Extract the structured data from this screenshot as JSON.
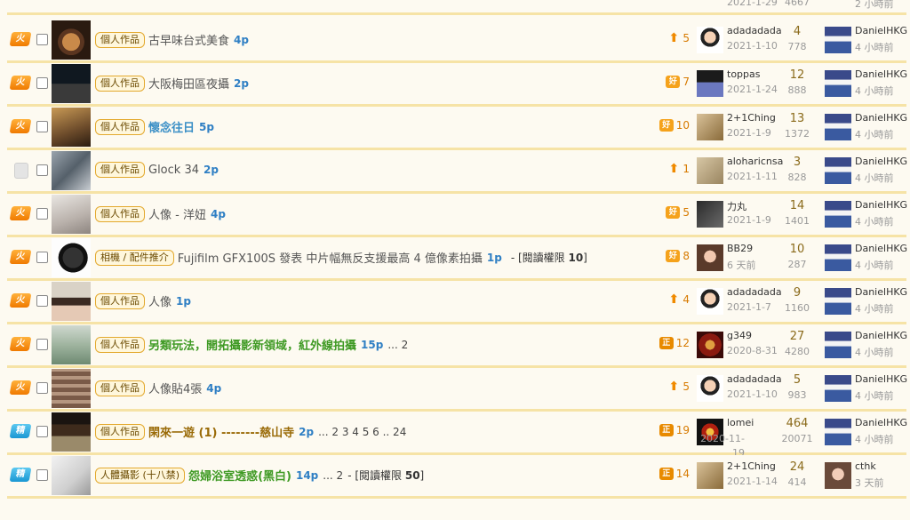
{
  "colors": {
    "row_bg": "#fdfaf1",
    "separator": "#f6e3a6",
    "pages_blue": "#2f7fc4",
    "rating_orange": "#d77a00"
  },
  "top_row": {
    "date": "2021-1-29",
    "views": "4667",
    "last_time": "2 小時前"
  },
  "threads": [
    {
      "status": "hot",
      "status_label": "火",
      "tag": "個人作品",
      "title": "古早味台式美食",
      "title_style": "normal",
      "pages": "4p",
      "page_nums": "",
      "perm_label": "",
      "perm_value": "",
      "perm_close": "",
      "rating_icon": "arrow",
      "rating_label": "⬆",
      "rating": "5",
      "author": "adadadada",
      "date": "2021-1-10",
      "replies": "4",
      "views": "778",
      "last_user": "DanielHKG",
      "last_time": "4 小時前"
    },
    {
      "status": "hot",
      "status_label": "火",
      "tag": "個人作品",
      "title": "大阪梅田區夜攝",
      "title_style": "normal",
      "pages": "2p",
      "page_nums": "",
      "perm_label": "",
      "perm_value": "",
      "perm_close": "",
      "rating_icon": "good",
      "rating_label": "好",
      "rating": "7",
      "author": "toppas",
      "date": "2021-1-24",
      "replies": "12",
      "views": "888",
      "last_user": "DanielHKG",
      "last_time": "4 小時前"
    },
    {
      "status": "hot",
      "status_label": "火",
      "tag": "個人作品",
      "title": "懷念往日",
      "title_style": "blue",
      "pages": "5p",
      "page_nums": "",
      "perm_label": "",
      "perm_value": "",
      "perm_close": "",
      "rating_icon": "good",
      "rating_label": "好",
      "rating": "10",
      "author": "2+1Ching",
      "date": "2021-1-9",
      "replies": "13",
      "views": "1372",
      "last_user": "DanielHKG",
      "last_time": "4 小時前"
    },
    {
      "status": "normal",
      "status_label": "",
      "tag": "個人作品",
      "title": "Glock 34",
      "title_style": "normal",
      "pages": "2p",
      "page_nums": "",
      "perm_label": "",
      "perm_value": "",
      "perm_close": "",
      "rating_icon": "arrow",
      "rating_label": "⬆",
      "rating": "1",
      "author": "aloharicnsa",
      "date": "2021-1-11",
      "replies": "3",
      "views": "828",
      "last_user": "DanielHKG",
      "last_time": "4 小時前"
    },
    {
      "status": "hot",
      "status_label": "火",
      "tag": "個人作品",
      "title": "人像 - 洋妞",
      "title_style": "normal",
      "pages": "4p",
      "page_nums": "",
      "perm_label": "",
      "perm_value": "",
      "perm_close": "",
      "rating_icon": "good",
      "rating_label": "好",
      "rating": "5",
      "author": "力丸",
      "date": "2021-1-9",
      "replies": "14",
      "views": "1401",
      "last_user": "DanielHKG",
      "last_time": "4 小時前"
    },
    {
      "status": "hot",
      "status_label": "火",
      "tag": "相機 / 配件推介",
      "title": "Fujifilm GFX100S 發表 中片幅無反支援最高 4 億像素拍攝",
      "title_style": "normal",
      "pages": "1p",
      "page_nums": "",
      "perm_label": "- [閱讀權限",
      "perm_value": "10",
      "perm_close": "]",
      "rating_icon": "good",
      "rating_label": "好",
      "rating": "8",
      "author": "BB29",
      "date": "6 天前",
      "replies": "10",
      "views": "287",
      "last_user": "DanielHKG",
      "last_time": "4 小時前"
    },
    {
      "status": "hot",
      "status_label": "火",
      "tag": "個人作品",
      "title": "人像",
      "title_style": "normal",
      "pages": "1p",
      "page_nums": "",
      "perm_label": "",
      "perm_value": "",
      "perm_close": "",
      "rating_icon": "arrow",
      "rating_label": "⬆",
      "rating": "4",
      "author": "adadadada",
      "date": "2021-1-7",
      "replies": "9",
      "views": "1160",
      "last_user": "DanielHKG",
      "last_time": "4 小時前"
    },
    {
      "status": "hot",
      "status_label": "火",
      "tag": "個人作品",
      "title": "另類玩法，開拓攝影新領域，紅外線拍攝",
      "title_style": "green",
      "pages": "15p",
      "page_nums": "... 2",
      "perm_label": "",
      "perm_value": "",
      "perm_close": "",
      "rating_icon": "right",
      "rating_label": "正",
      "rating": "12",
      "author": "g349",
      "date": "2020-8-31",
      "replies": "27",
      "views": "4280",
      "last_user": "DanielHKG",
      "last_time": "4 小時前"
    },
    {
      "status": "hot",
      "status_label": "火",
      "tag": "個人作品",
      "title": "人像貼4張",
      "title_style": "normal",
      "pages": "4p",
      "page_nums": "",
      "perm_label": "",
      "perm_value": "",
      "perm_close": "",
      "rating_icon": "arrow",
      "rating_label": "⬆",
      "rating": "5",
      "author": "adadadada",
      "date": "2021-1-10",
      "replies": "5",
      "views": "983",
      "last_user": "DanielHKG",
      "last_time": "4 小時前"
    },
    {
      "status": "elite",
      "status_label": "精",
      "tag": "個人作品",
      "title": "閑來一遊 (1) --------慈山寺",
      "title_style": "brown",
      "pages": "2p",
      "page_nums": "... 2 3 4 5 6 .. 24",
      "perm_label": "",
      "perm_value": "",
      "perm_close": "",
      "rating_icon": "right",
      "rating_label": "正",
      "rating": "19",
      "author": "lomei",
      "date": "2020-11-19",
      "replies": "464",
      "views": "20071",
      "last_user": "DanielHKG",
      "last_time": "4 小時前"
    },
    {
      "status": "elite",
      "status_label": "精",
      "tag": "人體攝影 (十八禁)",
      "title": "怨婦浴室透惑(黑白)",
      "title_style": "green",
      "pages": "14p",
      "page_nums": "... 2",
      "perm_label": "- [閱讀權限",
      "perm_value": "50",
      "perm_close": "]",
      "rating_icon": "right",
      "rating_label": "正",
      "rating": "14",
      "author": "2+1Ching",
      "date": "2021-1-14",
      "replies": "24",
      "views": "414",
      "last_user": "cthk",
      "last_time": "3 天前"
    }
  ]
}
